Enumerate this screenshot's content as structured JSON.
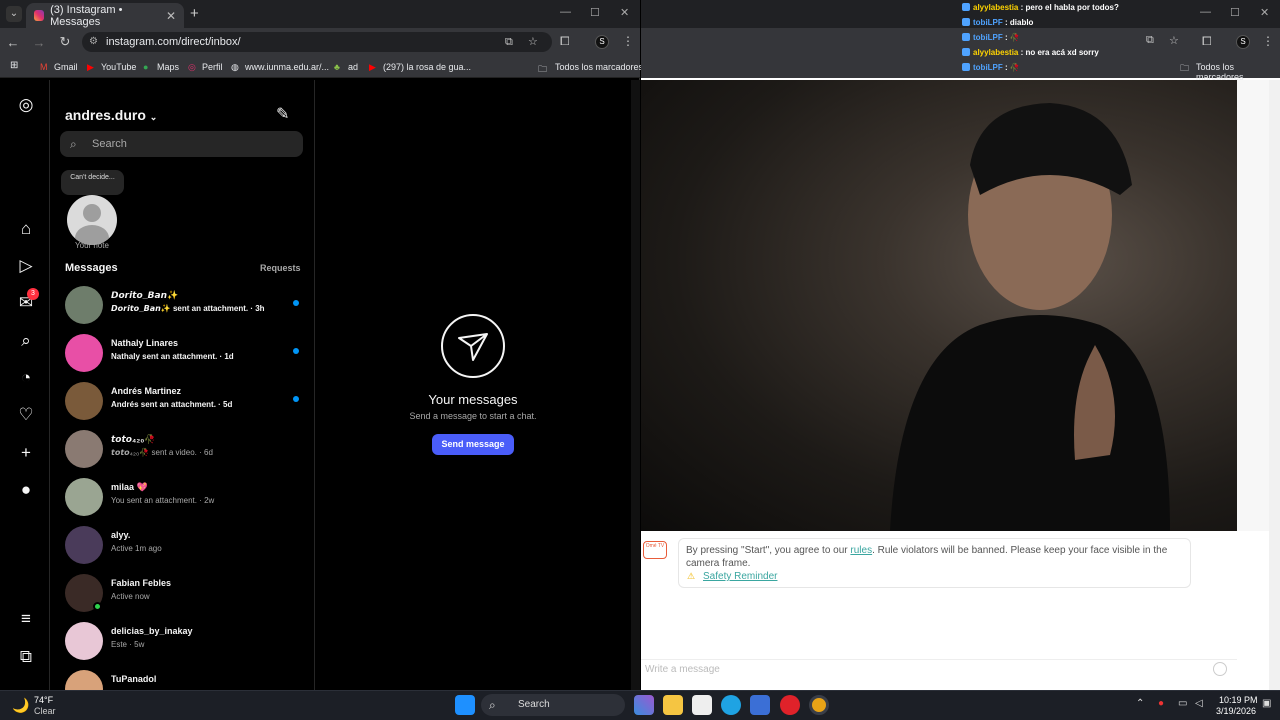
{
  "left_browser": {
    "tab_title": "(3) Instagram • Messages",
    "url": "instagram.com/direct/inbox/",
    "bookmarks": [
      "Gmail",
      "YouTube",
      "Maps",
      "Perfil",
      "www.iunma.edu.ar/...",
      "ad",
      "(297) la rosa de gua..."
    ],
    "all_bookmarks": "Todos los marcadores",
    "profile_letter": "S"
  },
  "instagram": {
    "username": "andres.duro",
    "search_placeholder": "Search",
    "note_bubble": "Can't decide...",
    "note_label": "Your note",
    "messages_title": "Messages",
    "requests_label": "Requests",
    "notifications_badge": "3",
    "conversations": [
      {
        "name": "𝘿𝙤𝙧𝙞𝙩𝙤_𝘽𝙖𝙣✨",
        "preview": "𝘿𝙤𝙧𝙞𝙩𝙤_𝘽𝙖𝙣✨ sent an attachment. · 3h",
        "unread": true,
        "color": "#6e7d6b"
      },
      {
        "name": "Nathaly Linares",
        "preview": "Nathaly sent an attachment. · 1d",
        "unread": true,
        "color": "#e84fa6"
      },
      {
        "name": "Andrés Martinez",
        "preview": "Andrés sent an attachment. · 5d",
        "unread": true,
        "color": "#7a5a3a"
      },
      {
        "name": "𝙩𝙤𝙩𝙤₄₂₀🥀",
        "preview": "𝙩𝙤𝙩𝙤₄₂₀🥀 sent a video. · 6d",
        "unread": false,
        "color": "#8a7a72"
      },
      {
        "name": "milaa 💖",
        "preview": "You sent an attachment. · 2w",
        "unread": false,
        "color": "#9aa592"
      },
      {
        "name": "alyy.",
        "preview": "Active 1m ago",
        "unread": false,
        "color": "#4a3b5a"
      },
      {
        "name": "Fabian Febles",
        "preview": "Active now",
        "unread": false,
        "color": "#3a2a26",
        "online": true
      },
      {
        "name": "delicias_by_inakay",
        "preview": "Este · 5w",
        "unread": false,
        "color": "#e8c7d6"
      },
      {
        "name": "TuPanadol",
        "preview": "",
        "unread": false,
        "color": "#d8a27a"
      }
    ],
    "empty_title": "Your messages",
    "empty_sub": "Send a message to start a chat.",
    "send_button": "Send message"
  },
  "right_page": {
    "bookmarks_all": "Todos los marcadores",
    "profile_letter": "S",
    "chat_overlay": [
      {
        "user": "alyylabestia",
        "text": " : pero el habla por todos?",
        "style": "u1"
      },
      {
        "user": "tobiLPF",
        "text": " : diablo",
        "style": "u2"
      },
      {
        "user": "tobiLPF",
        "text": " : 🥀",
        "style": "u2"
      },
      {
        "user": "alyylabestia",
        "text": " : no era acá xd sorry",
        "style": "u1"
      },
      {
        "user": "tobiLPF",
        "text": " : 🥀",
        "style": "u2"
      }
    ],
    "ome_icon_text": "Omé TV",
    "notice_before": "By pressing \"Start\", you agree to our ",
    "notice_link": "rules",
    "notice_after": ". Rule violators will be banned. Please keep your face visible in the camera frame.",
    "safety_reminder": "Safety Reminder",
    "write_placeholder": "Write a message"
  },
  "taskbar": {
    "temperature": "74°F",
    "condition": "Clear",
    "search_label": "Search",
    "time": "10:19 PM",
    "date": "3/19/2026"
  }
}
